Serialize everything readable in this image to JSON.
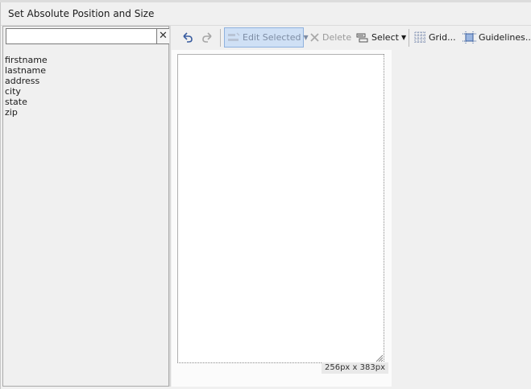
{
  "dialog": {
    "title": "Set Absolute Position and Size"
  },
  "search": {
    "value": "",
    "clear_label": "✕"
  },
  "fields": [
    "firstname",
    "lastname",
    "address",
    "city",
    "state",
    "zip"
  ],
  "toolbar": {
    "undo_icon": "undo-icon",
    "redo_icon": "redo-icon",
    "edit_selected_label": "Edit Selected",
    "delete_label": "Delete",
    "select_label": "Select",
    "grid_label": "Grid...",
    "guidelines_label": "Guidelines..."
  },
  "canvas": {
    "size_label": "256px x 383px"
  },
  "colors": {
    "accent_highlight": "#cfe0f5",
    "disabled_text": "#9a9a9a"
  }
}
